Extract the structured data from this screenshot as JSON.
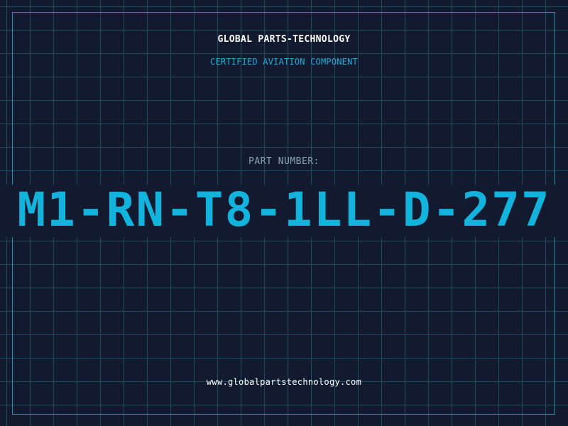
{
  "header": {
    "company": "GLOBAL PARTS-TECHNOLOGY",
    "subtitle": "CERTIFIED AVIATION COMPONENT"
  },
  "part": {
    "label": "PART NUMBER:",
    "number": "M1-RN-T8-1LL-D-277"
  },
  "footer": {
    "website": "www.globalpartstechnology.com"
  },
  "colors": {
    "background": "#111a2e",
    "grid": "#1d4a5e",
    "accent": "#12b3dc",
    "label": "#8aa3b8",
    "text": "#ffffff"
  }
}
